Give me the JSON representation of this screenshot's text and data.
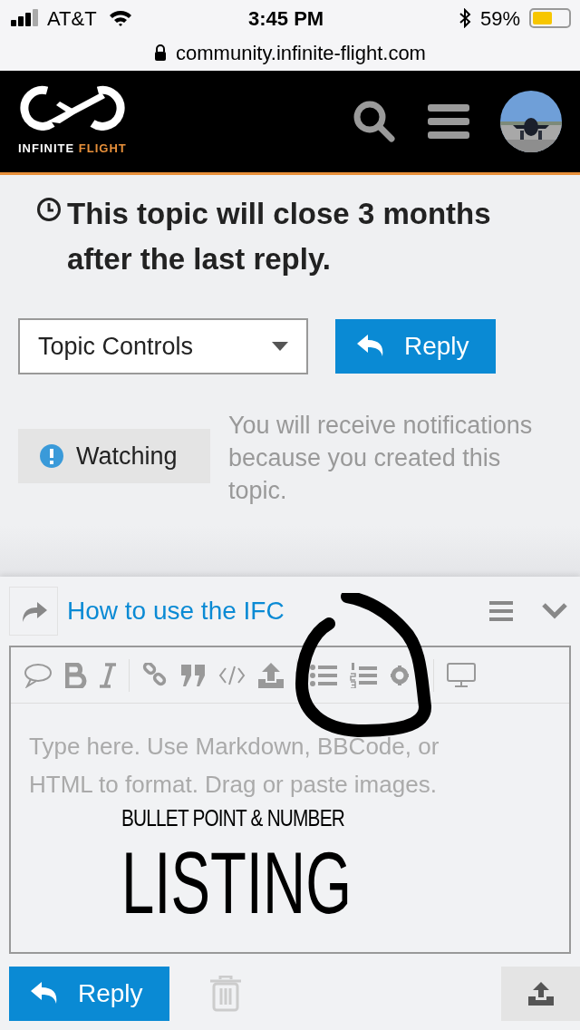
{
  "status_bar": {
    "carrier": "AT&T",
    "time": "3:45 PM",
    "battery": "59%"
  },
  "url_bar": {
    "url": "community.infinite-flight.com"
  },
  "site_header": {
    "logo_text_1": "INFINITE",
    "logo_text_2": "FLIGHT"
  },
  "topic_notice": "This topic will close 3 months after the last reply.",
  "topic_controls": {
    "label": "Topic Controls"
  },
  "reply_button": "Reply",
  "notification": {
    "button": "Watching",
    "description": "You will receive notifications because you created this topic."
  },
  "composer": {
    "title": "How to use the IFC",
    "placeholder": "Type here. Use Markdown, BBCode, or HTML to format. Drag or paste images.",
    "reply_button": "Reply"
  },
  "annotation": {
    "line_1": "BULLET POINT & NUMBER",
    "line_2": "LISTING"
  }
}
